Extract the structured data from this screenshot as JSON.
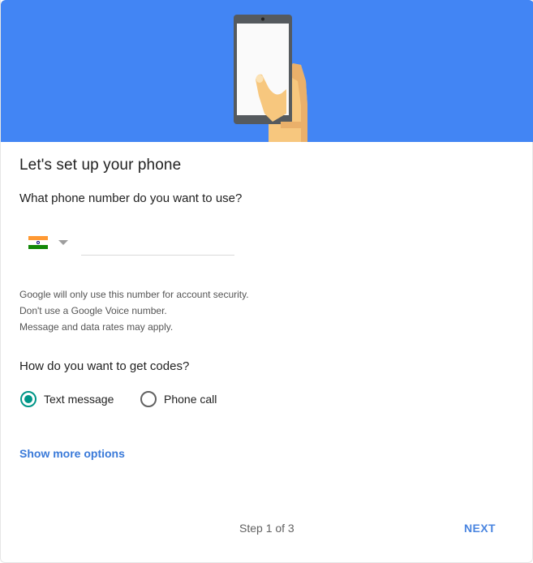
{
  "hero": {
    "illustration": "hand-holding-phone-illustration",
    "background_color": "#4285f4"
  },
  "title": "Let's set up your phone",
  "phone_question": "What phone number do you want to use?",
  "country_select": {
    "selected_flag": "india-flag-icon",
    "caret_icon": "dropdown-caret-icon"
  },
  "phone_input": {
    "value": "",
    "placeholder": ""
  },
  "info_lines": [
    "Google will only use this number for account security.",
    "Don't use a Google Voice number.",
    "Message and data rates may apply."
  ],
  "codes_question": "How do you want to get codes?",
  "delivery_options": [
    {
      "label": "Text message",
      "selected": true
    },
    {
      "label": "Phone call",
      "selected": false
    }
  ],
  "more_options_link": "Show more options",
  "footer": {
    "step_text": "Step 1 of 3",
    "next_label": "NEXT"
  },
  "colors": {
    "accent": "#4285f4",
    "radio_selected": "#009688",
    "link": "#3a7ad9"
  }
}
